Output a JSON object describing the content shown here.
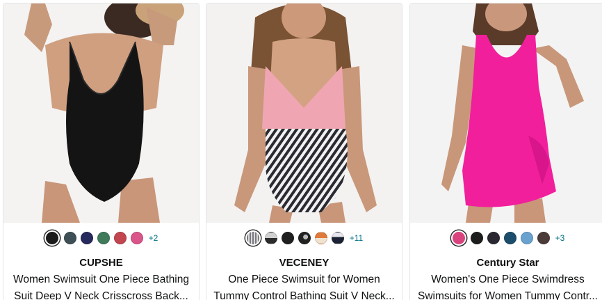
{
  "products": [
    {
      "brand": "CUPSHE",
      "title_line1": "Women Swimsuit One Piece Bathing",
      "title_line2": "Suit Deep V Neck Crisscross Back...",
      "more_colors": "+2",
      "swatch_colors": [
        "#1b1b1b",
        "#3e4f56",
        "#25295c",
        "#3f7a5a",
        "#c2454f",
        "#d9558a"
      ],
      "image_alt": "Black one piece swimsuit"
    },
    {
      "brand": "VECENEY",
      "title_line1": "One Piece Swimsuit for Women",
      "title_line2": "Tummy Control Bathing Suit V Neck...",
      "more_colors": "+11",
      "swatch_colors": [
        "#a9a9ac",
        "#9c9c9c",
        "#1f1f1f",
        "#2a2a2a",
        "#e07a3a",
        "#1c2233"
      ],
      "image_alt": "Pink and striped one piece swimsuit"
    },
    {
      "brand": "Century Star",
      "title_line1": "Women's One Piece Swimdress",
      "title_line2": "Swimsuits for Women Tummy Contr...",
      "more_colors": "+3",
      "swatch_colors": [
        "#d9447f",
        "#1d1d1d",
        "#2b2730",
        "#1c4d6b",
        "#6aa2cf",
        "#4b3b38"
      ],
      "image_alt": "Hot pink one piece swimdress"
    }
  ],
  "colors": {
    "link": "#007185",
    "text": "#0f1111",
    "card_border": "#e3e6e6"
  }
}
